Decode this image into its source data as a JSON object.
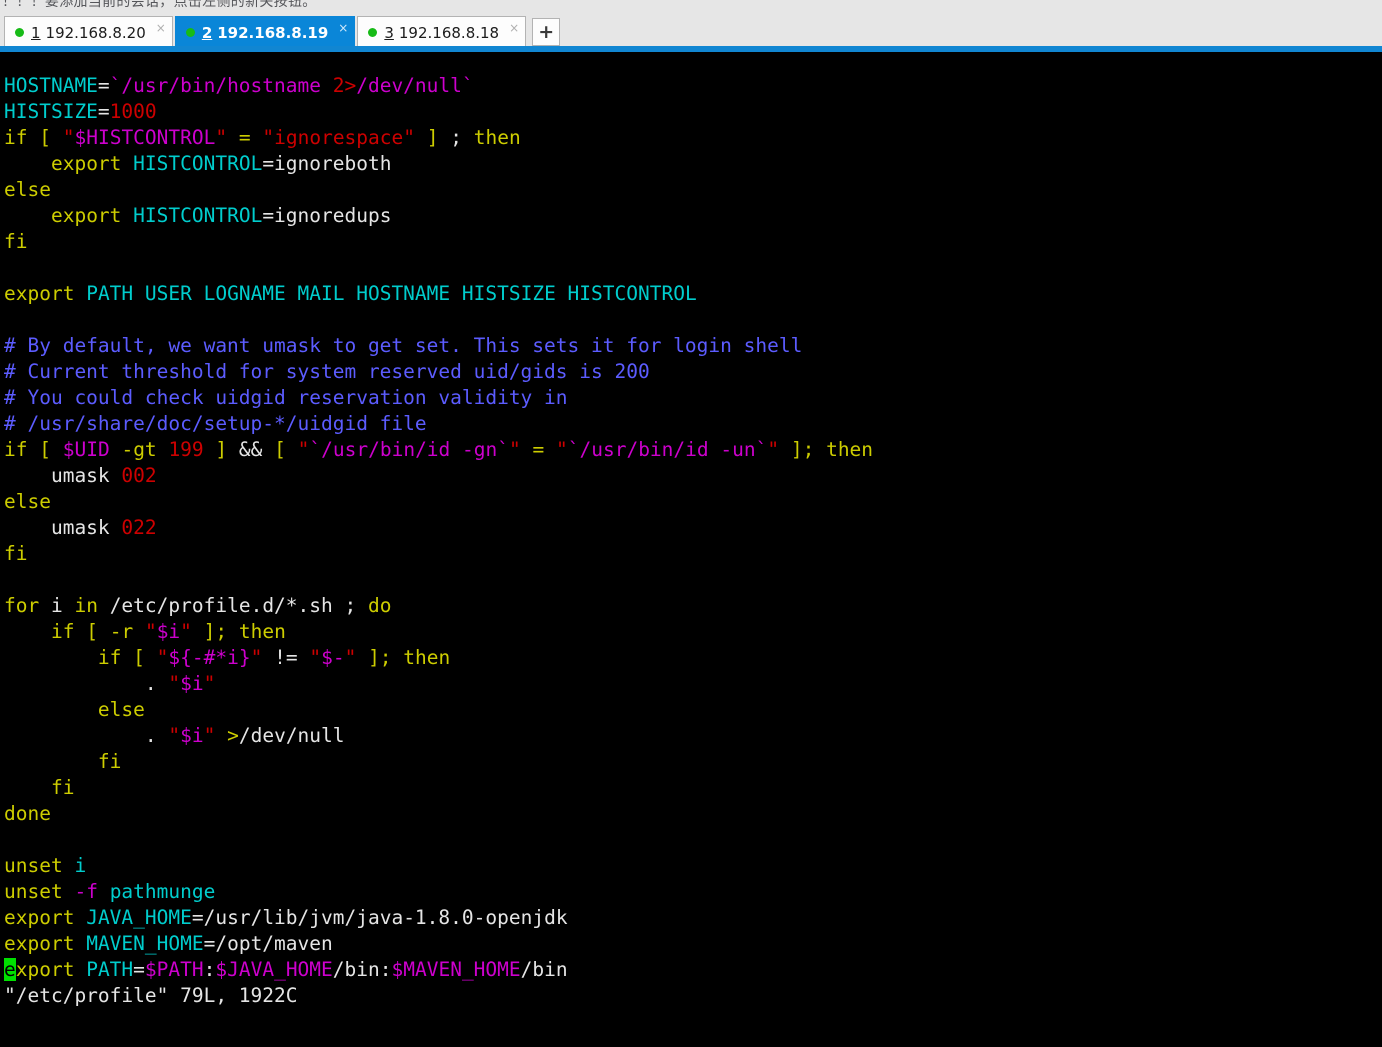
{
  "hint": {
    "text": "！！！要添加当前的会话，点击左侧的新关按钮。"
  },
  "tabbar": {
    "accent_color": "#1186d2",
    "active_tab_color": "#0a86d8",
    "status_dot_color": "#17bb17",
    "new_tab_label": "+",
    "new_tab_name": "new-tab-button",
    "close_glyph": "×",
    "tabs": [
      {
        "index": "1",
        "label": "192.168.8.20",
        "active": false,
        "status": "connected"
      },
      {
        "index": "2",
        "label": "192.168.8.19",
        "active": true,
        "status": "connected"
      },
      {
        "index": "3",
        "label": "192.168.8.18",
        "active": false,
        "status": "connected"
      }
    ]
  },
  "terminal": {
    "background": "#000000",
    "cursor_color": "#00e000",
    "cursor_char": "e",
    "status_line": "\"/etc/profile\" 79L, 1922C",
    "file_name": "/etc/profile",
    "line_count": "79L",
    "byte_count": "1922C",
    "lines": [
      {
        "segs": [
          {
            "t": "HOSTNAME",
            "c": "c-cyan"
          },
          {
            "t": "=",
            "c": "c-white"
          },
          {
            "t": "`/usr/bin/hostname ",
            "c": "c-mag"
          },
          {
            "t": "2>",
            "c": "c-red"
          },
          {
            "t": "/dev/null`",
            "c": "c-mag"
          }
        ]
      },
      {
        "segs": [
          {
            "t": "HISTSIZE",
            "c": "c-cyan"
          },
          {
            "t": "=",
            "c": "c-white"
          },
          {
            "t": "1000",
            "c": "c-red"
          }
        ]
      },
      {
        "segs": [
          {
            "t": "if",
            "c": "c-yellow"
          },
          {
            "t": " ",
            "c": "c-white"
          },
          {
            "t": "[",
            "c": "c-yellow"
          },
          {
            "t": " ",
            "c": "c-white"
          },
          {
            "t": "\"",
            "c": "c-red"
          },
          {
            "t": "$HISTCONTROL",
            "c": "c-mag"
          },
          {
            "t": "\"",
            "c": "c-red"
          },
          {
            "t": " ",
            "c": "c-white"
          },
          {
            "t": "=",
            "c": "c-yellow"
          },
          {
            "t": " ",
            "c": "c-white"
          },
          {
            "t": "\"ignorespace\"",
            "c": "c-red"
          },
          {
            "t": " ",
            "c": "c-white"
          },
          {
            "t": "]",
            "c": "c-yellow"
          },
          {
            "t": " ; ",
            "c": "c-white"
          },
          {
            "t": "then",
            "c": "c-yellow"
          }
        ]
      },
      {
        "segs": [
          {
            "t": "    ",
            "c": "c-white"
          },
          {
            "t": "export",
            "c": "c-yellow"
          },
          {
            "t": " ",
            "c": "c-white"
          },
          {
            "t": "HISTCONTROL",
            "c": "c-cyan"
          },
          {
            "t": "=ignoreboth",
            "c": "c-white"
          }
        ]
      },
      {
        "segs": [
          {
            "t": "else",
            "c": "c-yellow"
          }
        ]
      },
      {
        "segs": [
          {
            "t": "    ",
            "c": "c-white"
          },
          {
            "t": "export",
            "c": "c-yellow"
          },
          {
            "t": " ",
            "c": "c-white"
          },
          {
            "t": "HISTCONTROL",
            "c": "c-cyan"
          },
          {
            "t": "=ignoredups",
            "c": "c-white"
          }
        ]
      },
      {
        "segs": [
          {
            "t": "fi",
            "c": "c-yellow"
          }
        ]
      },
      {
        "segs": []
      },
      {
        "segs": [
          {
            "t": "export",
            "c": "c-yellow"
          },
          {
            "t": " ",
            "c": "c-white"
          },
          {
            "t": "PATH USER LOGNAME MAIL HOSTNAME HISTSIZE HISTCONTROL",
            "c": "c-cyan"
          }
        ]
      },
      {
        "segs": []
      },
      {
        "segs": [
          {
            "t": "# By default, we want umask to get set. This sets it for login shell",
            "c": "c-blue"
          }
        ]
      },
      {
        "segs": [
          {
            "t": "# Current threshold for system reserved uid/gids is 200",
            "c": "c-blue"
          }
        ]
      },
      {
        "segs": [
          {
            "t": "# You could check uidgid reservation validity in",
            "c": "c-blue"
          }
        ]
      },
      {
        "segs": [
          {
            "t": "# /usr/share/doc/setup-*/uidgid file",
            "c": "c-blue"
          }
        ]
      },
      {
        "segs": [
          {
            "t": "if",
            "c": "c-yellow"
          },
          {
            "t": " ",
            "c": "c-white"
          },
          {
            "t": "[",
            "c": "c-yellow"
          },
          {
            "t": " ",
            "c": "c-white"
          },
          {
            "t": "$UID",
            "c": "c-mag"
          },
          {
            "t": " ",
            "c": "c-white"
          },
          {
            "t": "-gt",
            "c": "c-yellow"
          },
          {
            "t": " ",
            "c": "c-white"
          },
          {
            "t": "199",
            "c": "c-red"
          },
          {
            "t": " ",
            "c": "c-white"
          },
          {
            "t": "]",
            "c": "c-yellow"
          },
          {
            "t": " ",
            "c": "c-white"
          },
          {
            "t": "&&",
            "c": "c-white"
          },
          {
            "t": " ",
            "c": "c-white"
          },
          {
            "t": "[",
            "c": "c-yellow"
          },
          {
            "t": " ",
            "c": "c-white"
          },
          {
            "t": "\"",
            "c": "c-red"
          },
          {
            "t": "`/usr/bin/id -gn`",
            "c": "c-mag"
          },
          {
            "t": "\"",
            "c": "c-red"
          },
          {
            "t": " ",
            "c": "c-white"
          },
          {
            "t": "=",
            "c": "c-yellow"
          },
          {
            "t": " ",
            "c": "c-white"
          },
          {
            "t": "\"",
            "c": "c-red"
          },
          {
            "t": "`/usr/bin/id -un`",
            "c": "c-mag"
          },
          {
            "t": "\"",
            "c": "c-red"
          },
          {
            "t": " ",
            "c": "c-white"
          },
          {
            "t": "];",
            "c": "c-yellow"
          },
          {
            "t": " ",
            "c": "c-white"
          },
          {
            "t": "then",
            "c": "c-yellow"
          }
        ]
      },
      {
        "segs": [
          {
            "t": "    umask ",
            "c": "c-white"
          },
          {
            "t": "002",
            "c": "c-red"
          }
        ]
      },
      {
        "segs": [
          {
            "t": "else",
            "c": "c-yellow"
          }
        ]
      },
      {
        "segs": [
          {
            "t": "    umask ",
            "c": "c-white"
          },
          {
            "t": "022",
            "c": "c-red"
          }
        ]
      },
      {
        "segs": [
          {
            "t": "fi",
            "c": "c-yellow"
          }
        ]
      },
      {
        "segs": []
      },
      {
        "segs": [
          {
            "t": "for",
            "c": "c-yellow"
          },
          {
            "t": " i ",
            "c": "c-white"
          },
          {
            "t": "in",
            "c": "c-yellow"
          },
          {
            "t": " /etc/profile.d/*.sh ; ",
            "c": "c-white"
          },
          {
            "t": "do",
            "c": "c-yellow"
          }
        ]
      },
      {
        "segs": [
          {
            "t": "    ",
            "c": "c-white"
          },
          {
            "t": "if",
            "c": "c-yellow"
          },
          {
            "t": " ",
            "c": "c-white"
          },
          {
            "t": "[",
            "c": "c-yellow"
          },
          {
            "t": " ",
            "c": "c-white"
          },
          {
            "t": "-r",
            "c": "c-yellow"
          },
          {
            "t": " ",
            "c": "c-white"
          },
          {
            "t": "\"",
            "c": "c-red"
          },
          {
            "t": "$i",
            "c": "c-mag"
          },
          {
            "t": "\"",
            "c": "c-red"
          },
          {
            "t": " ",
            "c": "c-white"
          },
          {
            "t": "];",
            "c": "c-yellow"
          },
          {
            "t": " ",
            "c": "c-white"
          },
          {
            "t": "then",
            "c": "c-yellow"
          }
        ]
      },
      {
        "segs": [
          {
            "t": "        ",
            "c": "c-white"
          },
          {
            "t": "if",
            "c": "c-yellow"
          },
          {
            "t": " ",
            "c": "c-white"
          },
          {
            "t": "[",
            "c": "c-yellow"
          },
          {
            "t": " ",
            "c": "c-white"
          },
          {
            "t": "\"",
            "c": "c-red"
          },
          {
            "t": "${-#*i}",
            "c": "c-mag"
          },
          {
            "t": "\"",
            "c": "c-red"
          },
          {
            "t": " ",
            "c": "c-white"
          },
          {
            "t": "!=",
            "c": "c-white"
          },
          {
            "t": " ",
            "c": "c-white"
          },
          {
            "t": "\"",
            "c": "c-red"
          },
          {
            "t": "$-",
            "c": "c-mag"
          },
          {
            "t": "\"",
            "c": "c-red"
          },
          {
            "t": " ",
            "c": "c-white"
          },
          {
            "t": "];",
            "c": "c-yellow"
          },
          {
            "t": " ",
            "c": "c-white"
          },
          {
            "t": "then",
            "c": "c-yellow"
          }
        ]
      },
      {
        "segs": [
          {
            "t": "            . ",
            "c": "c-white"
          },
          {
            "t": "\"",
            "c": "c-red"
          },
          {
            "t": "$i",
            "c": "c-mag"
          },
          {
            "t": "\"",
            "c": "c-red"
          }
        ]
      },
      {
        "segs": [
          {
            "t": "        ",
            "c": "c-white"
          },
          {
            "t": "else",
            "c": "c-yellow"
          }
        ]
      },
      {
        "segs": [
          {
            "t": "            . ",
            "c": "c-white"
          },
          {
            "t": "\"",
            "c": "c-red"
          },
          {
            "t": "$i",
            "c": "c-mag"
          },
          {
            "t": "\"",
            "c": "c-red"
          },
          {
            "t": " ",
            "c": "c-white"
          },
          {
            "t": ">",
            "c": "c-yellow"
          },
          {
            "t": "/dev/null",
            "c": "c-white"
          }
        ]
      },
      {
        "segs": [
          {
            "t": "        ",
            "c": "c-white"
          },
          {
            "t": "fi",
            "c": "c-yellow"
          }
        ]
      },
      {
        "segs": [
          {
            "t": "    ",
            "c": "c-white"
          },
          {
            "t": "fi",
            "c": "c-yellow"
          }
        ]
      },
      {
        "segs": [
          {
            "t": "done",
            "c": "c-yellow"
          }
        ]
      },
      {
        "segs": []
      },
      {
        "segs": [
          {
            "t": "unset",
            "c": "c-yellow"
          },
          {
            "t": " ",
            "c": "c-white"
          },
          {
            "t": "i",
            "c": "c-cyan"
          }
        ]
      },
      {
        "segs": [
          {
            "t": "unset",
            "c": "c-yellow"
          },
          {
            "t": " ",
            "c": "c-white"
          },
          {
            "t": "-f",
            "c": "c-mag"
          },
          {
            "t": " ",
            "c": "c-white"
          },
          {
            "t": "pathmunge",
            "c": "c-cyan"
          }
        ]
      },
      {
        "segs": [
          {
            "t": "export",
            "c": "c-yellow"
          },
          {
            "t": " ",
            "c": "c-white"
          },
          {
            "t": "JAVA_HOME",
            "c": "c-cyan"
          },
          {
            "t": "=/usr/lib/jvm/java-1.8.0-openjdk",
            "c": "c-white"
          }
        ]
      },
      {
        "segs": [
          {
            "t": "export",
            "c": "c-yellow"
          },
          {
            "t": " ",
            "c": "c-white"
          },
          {
            "t": "MAVEN_HOME",
            "c": "c-cyan"
          },
          {
            "t": "=/opt/maven",
            "c": "c-white"
          }
        ]
      },
      {
        "segs": [
          {
            "t": "e",
            "c": "cursor"
          },
          {
            "t": "xport",
            "c": "c-yellow"
          },
          {
            "t": " ",
            "c": "c-white"
          },
          {
            "t": "PATH",
            "c": "c-cyan"
          },
          {
            "t": "=",
            "c": "c-white"
          },
          {
            "t": "$PATH",
            "c": "c-mag"
          },
          {
            "t": ":",
            "c": "c-white"
          },
          {
            "t": "$JAVA_HOME",
            "c": "c-mag"
          },
          {
            "t": "/bin",
            "c": "c-white"
          },
          {
            "t": ":",
            "c": "c-white"
          },
          {
            "t": "$MAVEN_HOME",
            "c": "c-mag"
          },
          {
            "t": "/bin",
            "c": "c-white"
          }
        ]
      },
      {
        "segs": [
          {
            "t": "\"/etc/profile\" 79L, 1922C",
            "c": "c-white"
          }
        ]
      }
    ]
  }
}
